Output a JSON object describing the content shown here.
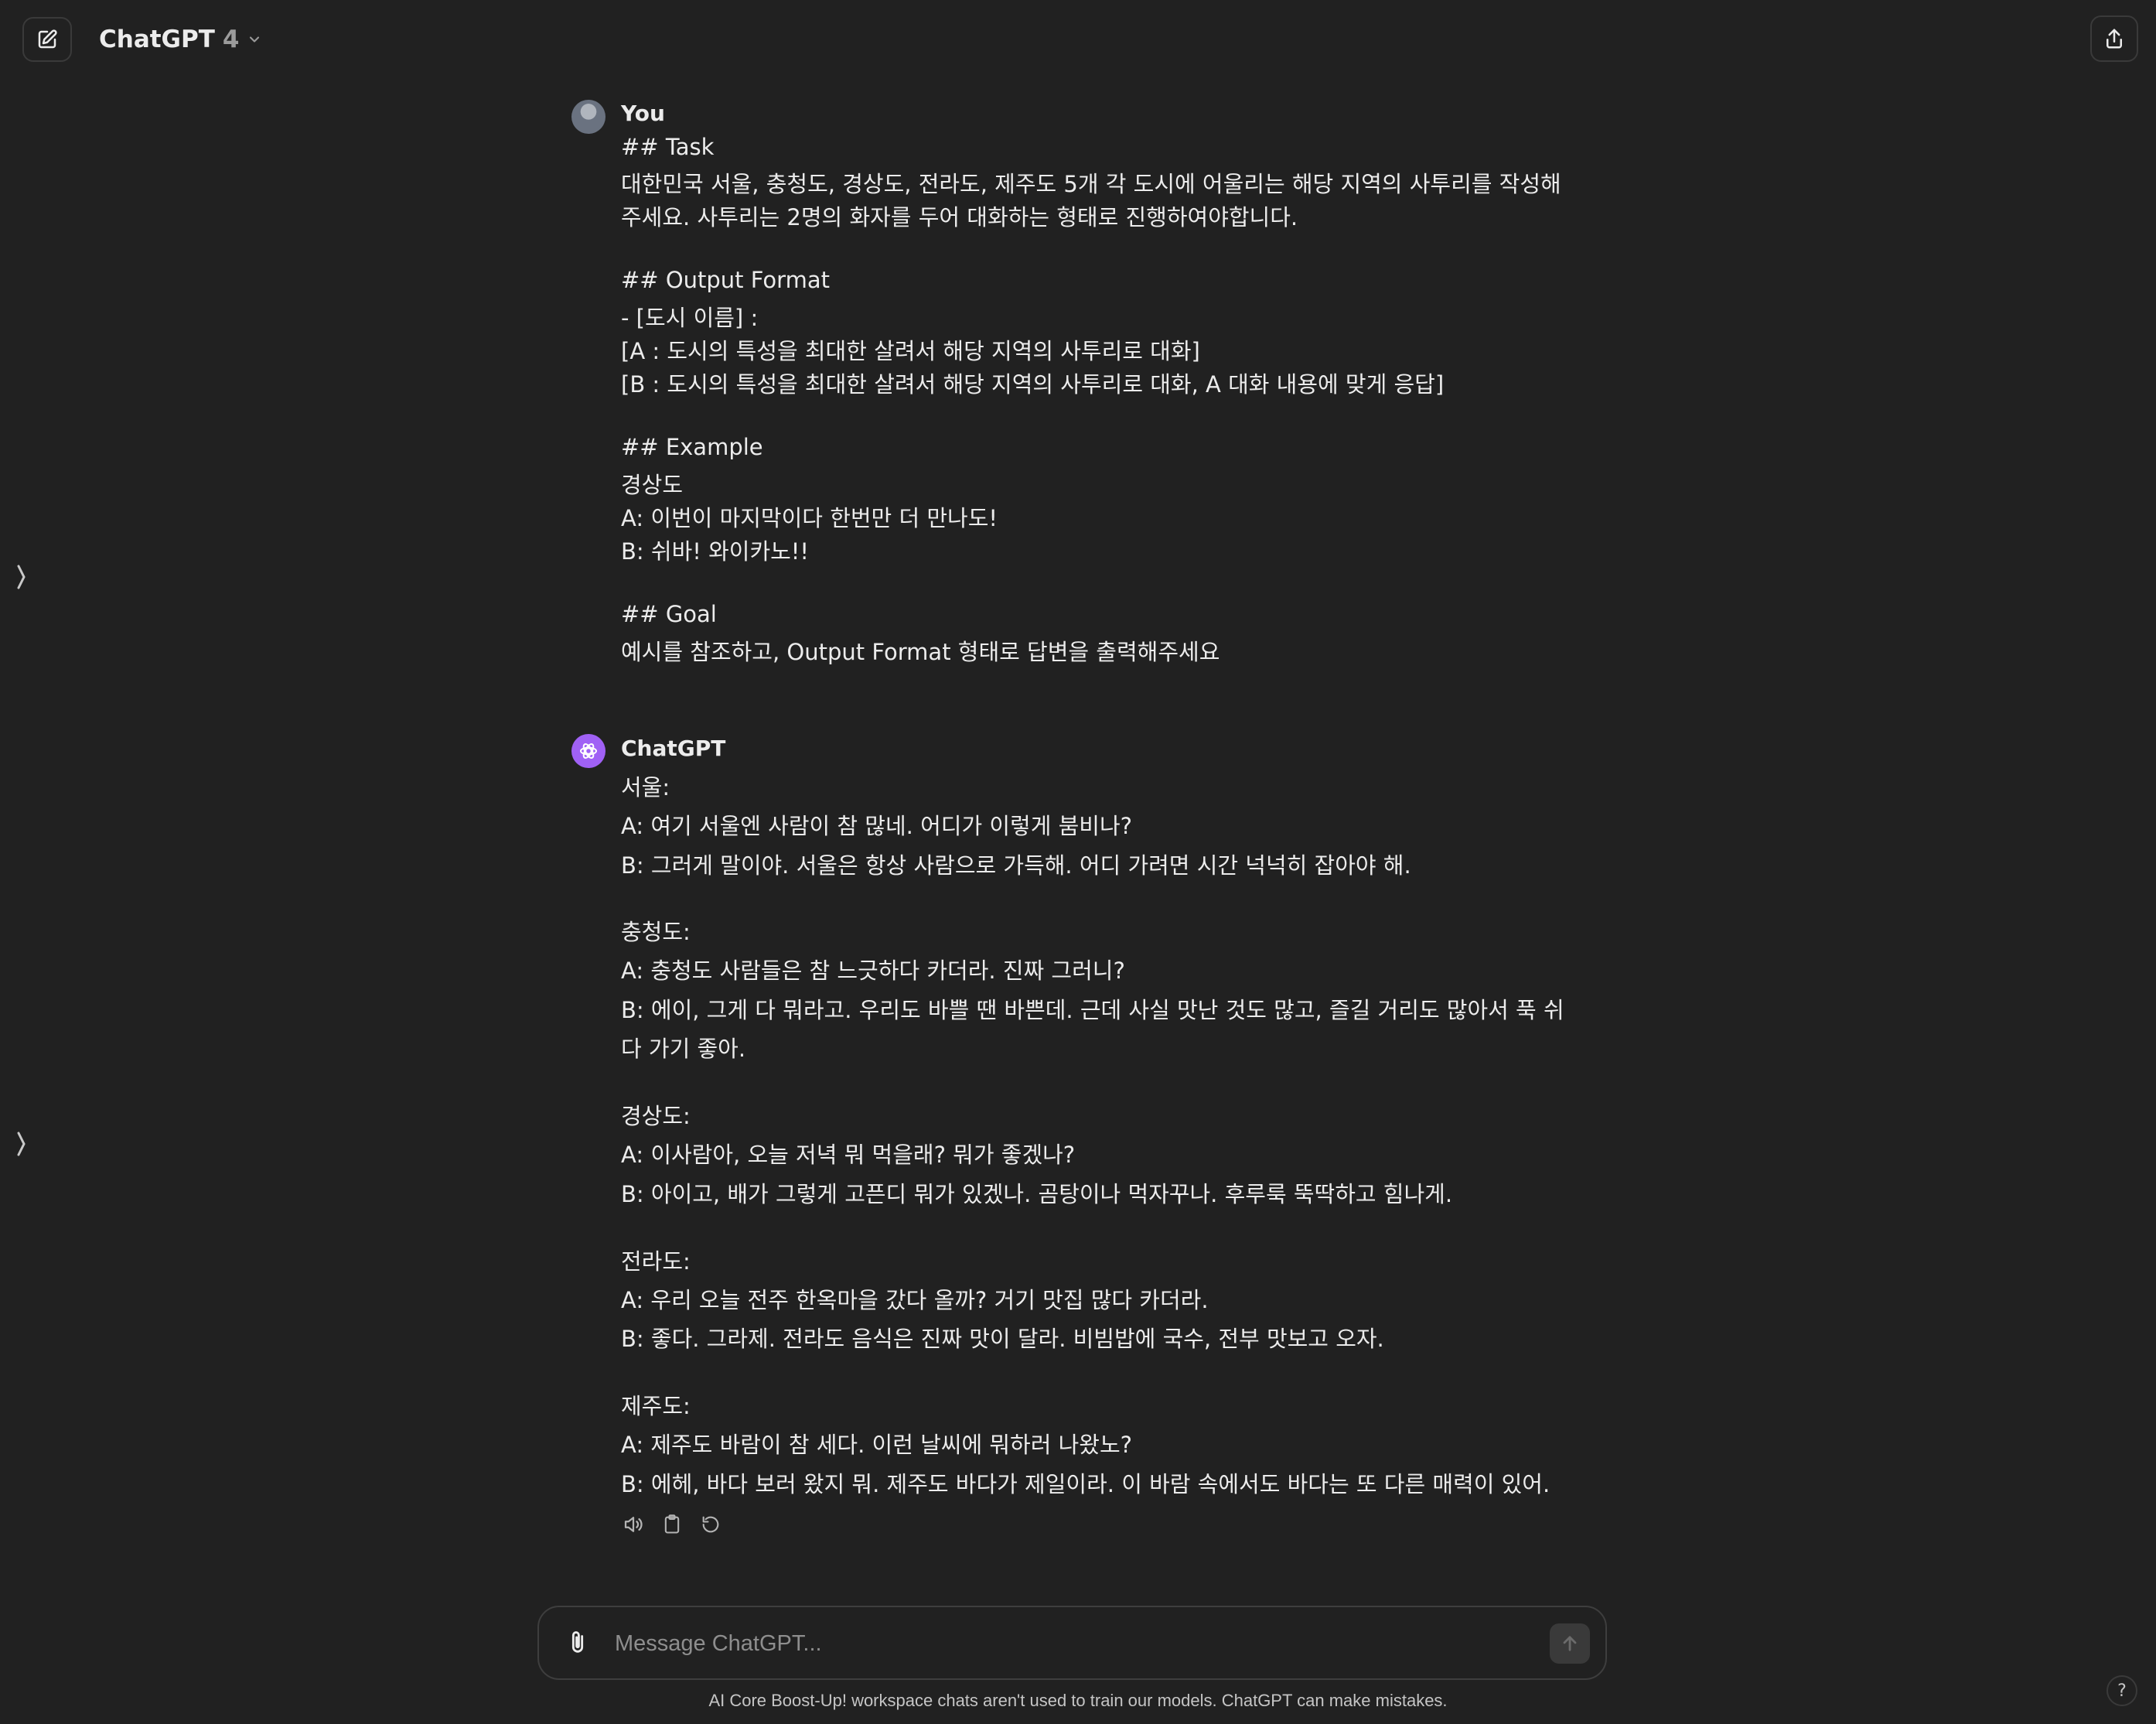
{
  "header": {
    "model_name": "ChatGPT",
    "model_version": "4"
  },
  "conversation": {
    "user_author": "You",
    "user_lines": [
      "## Task",
      "대한민국 서울, 충청도, 경상도, 전라도, 제주도 5개 각 도시에 어울리는 해당 지역의 사투리를 작성해",
      "주세요. 사투리는 2명의 화자를 두어 대화하는 형태로 진행하여야합니다.",
      "## Output Format",
      "- [도시 이름] :",
      "[A : 도시의 특성을 최대한 살려서 해당 지역의 사투리로 대화]",
      "[B : 도시의 특성을 최대한 살려서 해당 지역의 사투리로 대화, A 대화 내용에 맞게 응답]",
      "## Example",
      "경상도",
      "A: 이번이 마지막이다 한번만 더 만나도!",
      "B: 쉬바! 와이카노!!",
      "## Goal",
      "예시를 참조하고, Output Format 형태로 답변을 출력해주세요"
    ],
    "assistant_author": "ChatGPT",
    "assistant_lines": [
      "서울:",
      "A: 여기 서울엔 사람이 참 많네. 어디가 이렇게 붐비나?",
      "B: 그러게 말이야. 서울은 항상 사람으로 가득해. 어디 가려면 시간 넉넉히 잡아야 해.",
      "충청도:",
      "A: 충청도 사람들은 참 느긋하다 카더라. 진짜 그러니?",
      "B: 에이, 그게 다 뭐라고. 우리도 바쁠 땐 바쁜데. 근데 사실 맛난 것도 많고, 즐길 거리도 많아서 푹 쉬",
      "다 가기 좋아.",
      "경상도:",
      "A: 이사람아, 오늘 저녁 뭐 먹을래? 뭐가 좋겠나?",
      "B: 아이고, 배가 그렇게 고픈디 뭐가 있겠나. 곰탕이나 먹자꾸나. 후루룩 뚝딱하고 힘나게.",
      "전라도:",
      "A: 우리 오늘 전주 한옥마을 갔다 올까? 거기 맛집 많다 카더라.",
      "B: 좋다. 그라제. 전라도 음식은 진짜 맛이 달라. 비빔밥에 국수, 전부 맛보고 오자.",
      "제주도:",
      "A: 제주도 바람이 참 세다. 이런 날씨에 뭐하러 나왔노?",
      "B: 에헤, 바다 보러 왔지 뭐. 제주도 바다가 제일이라. 이 바람 속에서도 바다는 또 다른 매력이 있어."
    ]
  },
  "composer": {
    "placeholder": "Message ChatGPT..."
  },
  "footer": {
    "disclaimer": "AI Core Boost-Up! workspace chats aren't used to train our models. ChatGPT can make mistakes.",
    "help_label": "?"
  },
  "icons": {
    "new_chat": "pencil-square-icon",
    "model_menu": "chevron-down-icon",
    "share": "share-upload-icon",
    "sidebar_toggle": "chevron-right-icon",
    "read_aloud": "speaker-icon",
    "copy": "clipboard-icon",
    "regenerate": "refresh-icon",
    "attach": "paperclip-icon",
    "send": "arrow-up-icon"
  },
  "colors": {
    "background": "#212121",
    "text": "#ececec",
    "assistant_avatar": "#a061f5",
    "muted": "#9b9b9b"
  }
}
